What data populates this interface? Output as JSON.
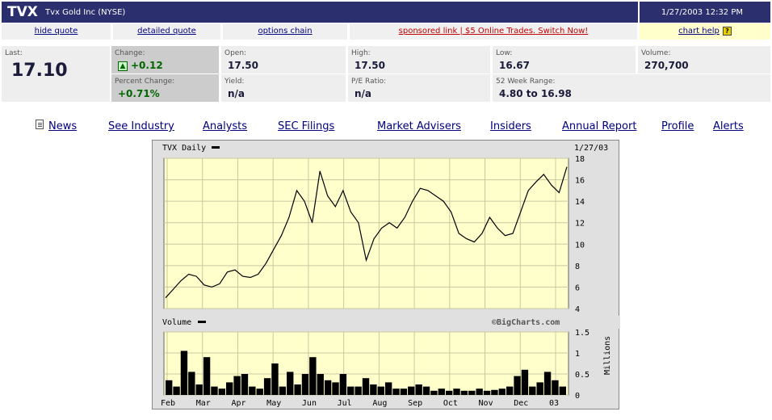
{
  "header": {
    "symbol": "TVX",
    "company": "Tvx Gold Inc (NYSE)",
    "datetime": "1/27/2003 12:32 PM"
  },
  "links": {
    "hide_quote": "hide quote",
    "detailed_quote": "detailed quote",
    "options_chain": "options chain",
    "sponsored": "sponsored link | $5 Online Trades. Switch Now!",
    "chart_help": "chart help",
    "help_icon": "?"
  },
  "quote": {
    "last_label": "Last:",
    "last": "17.10",
    "change_label": "Change:",
    "change": "+0.12",
    "pct_label": "Percent Change:",
    "pct": "+0.71%",
    "open_label": "Open:",
    "open": "17.50",
    "high_label": "High:",
    "high": "17.50",
    "low_label": "Low:",
    "low": "16.67",
    "volume_label": "Volume:",
    "volume": "270,700",
    "yield_label": "Yield:",
    "yield": "n/a",
    "pe_label": "P/E Ratio:",
    "pe": "n/a",
    "range_label": "52 Week Range:",
    "range": "4.80 to 16.98"
  },
  "nav": {
    "news": "News",
    "industry": "See Industry",
    "analysts": "Analysts",
    "sec": "SEC Filings",
    "advisers": "Market Advisers",
    "insiders": "Insiders",
    "annual": "Annual Report",
    "profile": "Profile",
    "alerts": "Alerts"
  },
  "icons": {
    "news": "document-icon",
    "change": "up-arrow-icon",
    "help": "question-icon"
  },
  "chart_data": {
    "type": "line",
    "price_label": "TVX Daily",
    "price_date": "1/27/03",
    "volume_label": "Volume",
    "watermark": "©BigCharts.com",
    "volume_unit": "Millions",
    "months": [
      "Feb",
      "Mar",
      "Apr",
      "May",
      "Jun",
      "Jul",
      "Aug",
      "Sep",
      "Oct",
      "Nov",
      "Dec",
      "03"
    ],
    "price_ticks": [
      "18",
      "16",
      "14",
      "12",
      "10",
      "8",
      "6",
      "4"
    ],
    "volume_ticks": [
      "1.5",
      "1",
      "0.5",
      "0"
    ],
    "ylim_price": [
      4,
      18
    ],
    "ylim_volume": [
      0,
      1.5
    ],
    "price": [
      5.0,
      5.8,
      6.6,
      7.2,
      7.0,
      6.2,
      6.0,
      6.3,
      7.4,
      7.6,
      7.0,
      6.9,
      7.2,
      8.2,
      9.5,
      10.8,
      12.5,
      15.0,
      14.0,
      12.0,
      16.8,
      14.5,
      13.5,
      15.0,
      13.0,
      12.0,
      8.5,
      10.5,
      11.5,
      12.0,
      11.5,
      12.5,
      14.0,
      15.2,
      15.0,
      14.5,
      14.0,
      13.0,
      11.0,
      10.5,
      10.2,
      11.0,
      12.5,
      11.5,
      10.8,
      11.0,
      13.0,
      15.0,
      15.8,
      16.5,
      15.5,
      14.8,
      17.2
    ],
    "volume": [
      0.35,
      0.2,
      1.05,
      0.55,
      0.25,
      0.9,
      0.2,
      0.15,
      0.3,
      0.45,
      0.5,
      0.2,
      0.15,
      0.4,
      0.75,
      0.2,
      0.55,
      0.25,
      0.5,
      0.9,
      0.5,
      0.35,
      0.3,
      0.5,
      0.2,
      0.2,
      0.4,
      0.25,
      0.2,
      0.3,
      0.15,
      0.15,
      0.2,
      0.25,
      0.2,
      0.1,
      0.15,
      0.1,
      0.15,
      0.1,
      0.1,
      0.15,
      0.1,
      0.12,
      0.15,
      0.2,
      0.45,
      0.6,
      0.2,
      0.3,
      0.55,
      0.35,
      0.2
    ]
  },
  "colors": {
    "header": "#2b2f6e",
    "plot_bg": "#ffffcc",
    "grid": "#c8c8a0"
  }
}
